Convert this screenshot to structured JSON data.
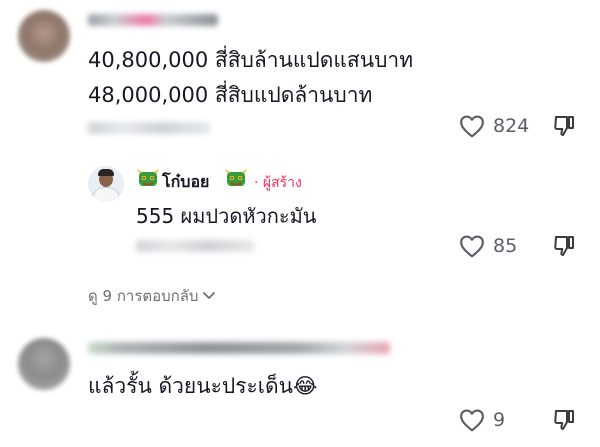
{
  "comments": [
    {
      "text_lines": [
        "40,800,000 สี่สิบล้านแปดแสนบาท",
        "48,000,000 สี่สิบแปดล้านบาท"
      ],
      "likes": "824"
    },
    {
      "reply": {
        "author": "โก๋บอย",
        "creator_label": "· ผู้สร้าง",
        "text": "555 ผมปวดหัวกะมัน",
        "likes": "85"
      },
      "view_replies_label": "ดู 9 การตอบกลับ"
    },
    {
      "text_lines": [
        "แล้วรั้น ด้วยนะประเด็น😂"
      ],
      "likes": "9"
    }
  ],
  "icons": {
    "like": "heart-outline-icon",
    "dislike": "thumbs-down-icon",
    "expand": "chevron-down-icon",
    "badge": "dragon-emoji-icon"
  },
  "colors": {
    "text": "#161823",
    "secondary": "#5c5c66",
    "creator_badge": "#fe2c55"
  }
}
